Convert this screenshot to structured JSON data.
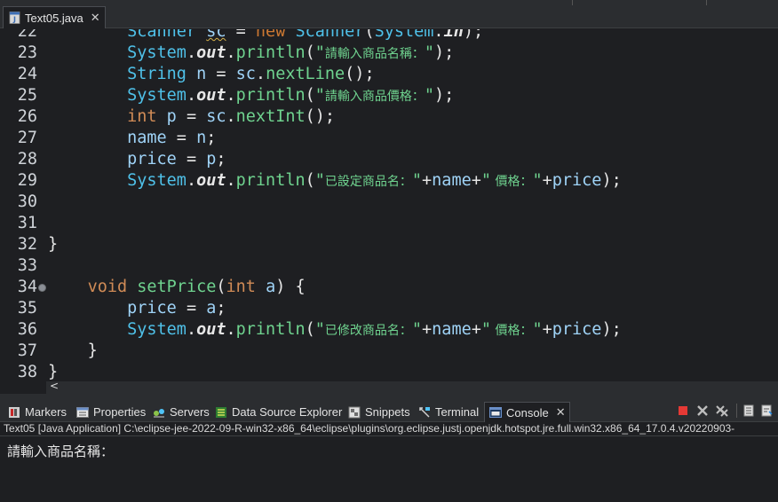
{
  "editor_tab": {
    "label": "Text05.java",
    "close": "✕"
  },
  "code_lines": [
    {
      "num": "22",
      "segments": [
        [
          "cls",
          "Scanner"
        ],
        [
          "pl",
          " "
        ],
        [
          "var sq",
          "sc"
        ],
        [
          "pl",
          " = "
        ],
        [
          "k",
          "new"
        ],
        [
          "pl",
          " "
        ],
        [
          "cls",
          "Scanner"
        ],
        [
          "pl",
          "("
        ],
        [
          "cls",
          "System"
        ],
        [
          "pl",
          "."
        ],
        [
          "st",
          "in"
        ],
        [
          "pl",
          ");"
        ]
      ]
    },
    {
      "num": "23",
      "segments": [
        [
          "cls",
          "System"
        ],
        [
          "pl",
          "."
        ],
        [
          "st",
          "out"
        ],
        [
          "pl",
          "."
        ],
        [
          "meth",
          "println"
        ],
        [
          "pl",
          "("
        ],
        [
          "str",
          "\""
        ],
        [
          "cjk",
          "請輸入商品名稱："
        ],
        [
          "str",
          "\""
        ],
        [
          "pl",
          ");"
        ]
      ]
    },
    {
      "num": "24",
      "segments": [
        [
          "cls",
          "String"
        ],
        [
          "pl",
          " "
        ],
        [
          "var",
          "n"
        ],
        [
          "pl",
          " = "
        ],
        [
          "var",
          "sc"
        ],
        [
          "pl",
          "."
        ],
        [
          "meth",
          "nextLine"
        ],
        [
          "pl",
          "();"
        ]
      ]
    },
    {
      "num": "25",
      "segments": [
        [
          "cls",
          "System"
        ],
        [
          "pl",
          "."
        ],
        [
          "st",
          "out"
        ],
        [
          "pl",
          "."
        ],
        [
          "meth",
          "println"
        ],
        [
          "pl",
          "("
        ],
        [
          "str",
          "\""
        ],
        [
          "cjk",
          "請輸入商品價格："
        ],
        [
          "str",
          "\""
        ],
        [
          "pl",
          ");"
        ]
      ]
    },
    {
      "num": "26",
      "segments": [
        [
          "kw",
          "int"
        ],
        [
          "pl",
          " "
        ],
        [
          "var",
          "p"
        ],
        [
          "pl",
          " = "
        ],
        [
          "var",
          "sc"
        ],
        [
          "pl",
          "."
        ],
        [
          "meth",
          "nextInt"
        ],
        [
          "pl",
          "();"
        ]
      ]
    },
    {
      "num": "27",
      "segments": [
        [
          "fld",
          "name"
        ],
        [
          "pl",
          " = "
        ],
        [
          "var",
          "n"
        ],
        [
          "pl",
          ";"
        ]
      ]
    },
    {
      "num": "28",
      "segments": [
        [
          "fld",
          "price"
        ],
        [
          "pl",
          " = "
        ],
        [
          "var",
          "p"
        ],
        [
          "pl",
          ";"
        ]
      ]
    },
    {
      "num": "29",
      "segments": [
        [
          "cls",
          "System"
        ],
        [
          "pl",
          "."
        ],
        [
          "st",
          "out"
        ],
        [
          "pl",
          "."
        ],
        [
          "meth",
          "println"
        ],
        [
          "pl",
          "("
        ],
        [
          "str",
          "\""
        ],
        [
          "cjk",
          "已設定商品名："
        ],
        [
          "str",
          "\""
        ],
        [
          "pl",
          "+"
        ],
        [
          "fld",
          "name"
        ],
        [
          "pl",
          "+"
        ],
        [
          "str",
          "\""
        ],
        [
          "cjk",
          " 價格："
        ],
        [
          "str",
          "\""
        ],
        [
          "pl",
          "+"
        ],
        [
          "fld",
          "price"
        ],
        [
          "pl",
          ");"
        ]
      ]
    },
    {
      "num": "30",
      "segments": []
    },
    {
      "num": "31",
      "segments": []
    },
    {
      "num": "32",
      "segments": [
        [
          "pl",
          "}"
        ]
      ]
    },
    {
      "num": "33",
      "segments": []
    },
    {
      "num": "34",
      "segments": [
        [
          "kw",
          "void"
        ],
        [
          "pl",
          " "
        ],
        [
          "meth",
          "setPrice"
        ],
        [
          "pl",
          "("
        ],
        [
          "kw",
          "int"
        ],
        [
          "pl",
          " "
        ],
        [
          "var",
          "a"
        ],
        [
          "pl",
          ") {"
        ]
      ]
    },
    {
      "num": "35",
      "segments": [
        [
          "fld",
          "price"
        ],
        [
          "pl",
          " = "
        ],
        [
          "var",
          "a"
        ],
        [
          "pl",
          ";"
        ]
      ]
    },
    {
      "num": "36",
      "segments": [
        [
          "cls",
          "System"
        ],
        [
          "pl",
          "."
        ],
        [
          "st",
          "out"
        ],
        [
          "pl",
          "."
        ],
        [
          "meth",
          "println"
        ],
        [
          "pl",
          "("
        ],
        [
          "str",
          "\""
        ],
        [
          "cjk",
          "已修改商品名："
        ],
        [
          "str",
          "\""
        ],
        [
          "pl",
          "+"
        ],
        [
          "fld",
          "name"
        ],
        [
          "pl",
          "+"
        ],
        [
          "str",
          "\""
        ],
        [
          "cjk",
          " 價格："
        ],
        [
          "str",
          "\""
        ],
        [
          "pl",
          "+"
        ],
        [
          "fld",
          "price"
        ],
        [
          "pl",
          ");"
        ]
      ]
    },
    {
      "num": "37",
      "segments": [
        [
          "pl",
          "}"
        ]
      ]
    },
    {
      "num": "38",
      "segments": [
        [
          "pl",
          "}"
        ]
      ]
    }
  ],
  "code_indents": [
    "        ",
    "        ",
    "        ",
    "        ",
    "        ",
    "        ",
    "        ",
    "        ",
    "",
    "",
    "",
    "",
    "    ",
    "        ",
    "        ",
    "    ",
    ""
  ],
  "scroll_arrow": "<",
  "views": [
    {
      "label": "Markers",
      "icon": "markers-icon"
    },
    {
      "label": "Properties",
      "icon": "properties-icon"
    },
    {
      "label": "Servers",
      "icon": "servers-icon"
    },
    {
      "label": "Data Source Explorer",
      "icon": "data-source-icon"
    },
    {
      "label": "Snippets",
      "icon": "snippets-icon"
    },
    {
      "label": "Terminal",
      "icon": "terminal-icon"
    },
    {
      "label": "Console",
      "icon": "console-icon",
      "active": true
    }
  ],
  "console": {
    "header": "Text05 [Java Application] C:\\eclipse-jee-2022-09-R-win32-x86_64\\eclipse\\plugins\\org.eclipse.justj.openjdk.hotspot.jre.full.win32.x86_64_17.0.4.v20220903-",
    "output": "請輸入商品名稱："
  },
  "colors": {
    "terminate": "#e53935",
    "background": "#1e1f22"
  }
}
